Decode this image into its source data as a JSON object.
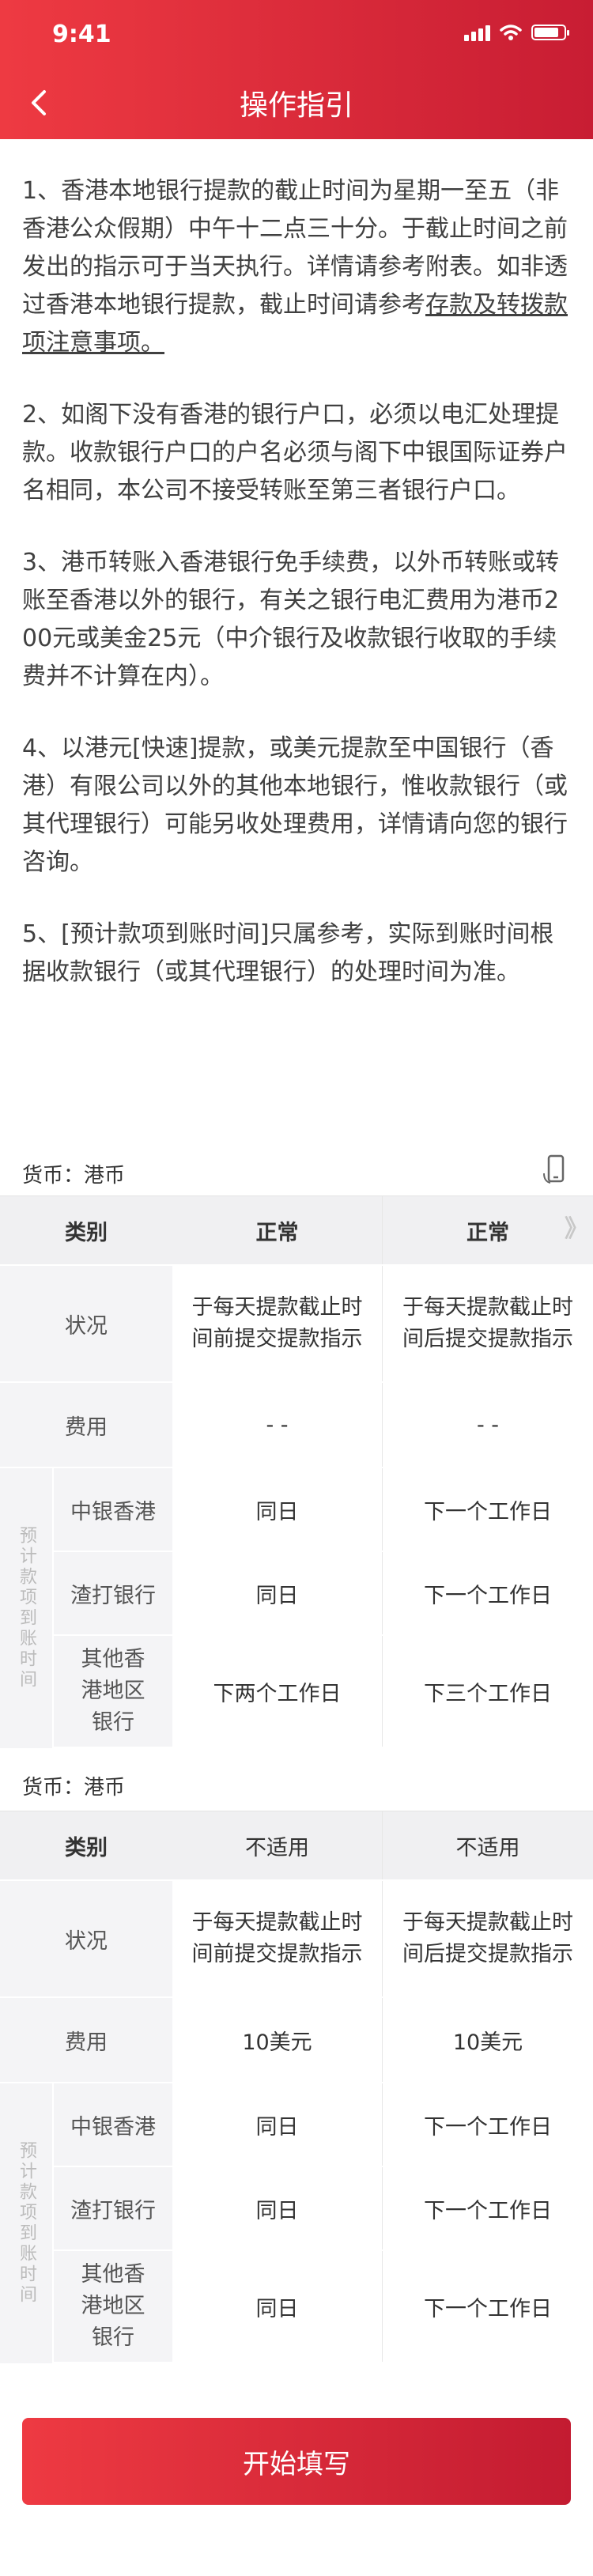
{
  "status_bar": {
    "time": "9:41"
  },
  "nav": {
    "title": "操作指引",
    "back_icon": "chevron-left-icon"
  },
  "notes": [
    {
      "text": "1、香港本地银行提款的截止时间为星期一至五（非香港公众假期）中午十二点三十分。于截止时间之前发出的指示可于当天执行。详情请参考附表。如非透过香港本地银行提款，截止时间请参考",
      "link": "存款及转拨款项注意事项。"
    },
    {
      "text": "2、如阁下没有香港的银行户口，必须以电汇处理提款。收款银行户口的户名必须与阁下中银国际证券户名相同，本公司不接受转账至第三者银行户口。"
    },
    {
      "text": "3、港币转账入香港银行免手续费，以外币转账或转账至香港以外的银行，有关之银行电汇费用为港币200元或美金25元（中介银行及收款银行收取的手续费并不计算在内）。"
    },
    {
      "text": "4、以港元[快速]提款，或美元提款至中国银行（香港）有限公司以外的其他本地银行，惟收款银行（或其代理银行）可能另收处理费用，详情请向您的银行咨询。"
    },
    {
      "text": "5、[预计款项到账时间]只属参考，实际到账时间根据收款银行（或其代理银行）的处理时间为准。"
    }
  ],
  "tables": [
    {
      "currency_label": "货币：港币",
      "show_phone_icon": true,
      "scroll_hint": "》",
      "headers": [
        "类别",
        "正常",
        "正常"
      ],
      "status": {
        "label": "状况",
        "values": [
          "于每天提款截止时间前提交提款指示",
          "于每天提款截止时间后提交提款指示"
        ]
      },
      "fee": {
        "label": "费用",
        "values": [
          "- -",
          "- -"
        ]
      },
      "arrival_group_label": "预计款项到账时间",
      "arrival_rows": [
        {
          "bank": "中银香港",
          "values": [
            "同日",
            "下一个工作日"
          ]
        },
        {
          "bank": "渣打银行",
          "values": [
            "同日",
            "下一个工作日"
          ]
        },
        {
          "bank": "其他香港地区银行",
          "values": [
            "下两个工作日",
            "下三个工作日"
          ]
        }
      ]
    },
    {
      "currency_label": "货币：港币",
      "show_phone_icon": false,
      "headers": [
        "类别",
        "不适用",
        "不适用"
      ],
      "status": {
        "label": "状况",
        "values": [
          "于每天提款截止时间前提交提款指示",
          "于每天提款截止时间后提交提款指示"
        ]
      },
      "fee": {
        "label": "费用",
        "values": [
          "10美元",
          "10美元"
        ]
      },
      "arrival_group_label": "预计款项到账时间",
      "arrival_rows": [
        {
          "bank": "中银香港",
          "values": [
            "同日",
            "下一个工作日"
          ]
        },
        {
          "bank": "渣打银行",
          "values": [
            "同日",
            "下一个工作日"
          ]
        },
        {
          "bank": "其他香港地区银行",
          "values": [
            "同日",
            "下一个工作日"
          ]
        }
      ]
    }
  ],
  "button": {
    "label": "开始填写"
  },
  "colors": {
    "brand_red": "#e8333c",
    "brand_red_dark": "#c31b31",
    "table_bg": "#f4f4f6"
  }
}
